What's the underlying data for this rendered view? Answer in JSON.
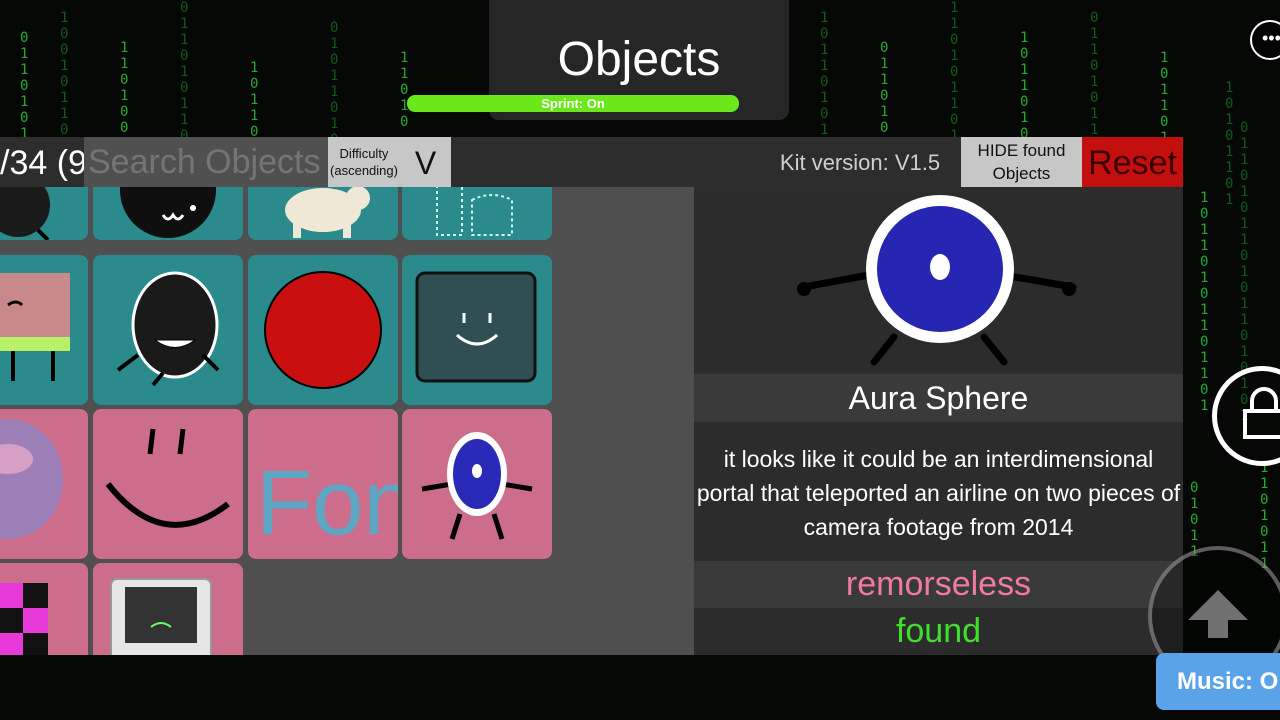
{
  "header": {
    "title": "Objects",
    "sprint_label": "Sprint: On"
  },
  "toolbar": {
    "count_text": "/34 (9",
    "search_placeholder": "Search Objects",
    "sort_label_1": "Difficulty",
    "sort_label_2": "(ascending)",
    "sort_toggle": "V",
    "kit_version": "Kit version: V1.5",
    "hide_found_1": "HIDE found",
    "hide_found_2": "Objects",
    "reset": "Reset"
  },
  "grid": {
    "items": [
      {
        "icon": "dark-ball-character-icon",
        "tile": "teal"
      },
      {
        "icon": "black-ball-face-icon",
        "tile": "teal"
      },
      {
        "icon": "dog-icon",
        "tile": "teal"
      },
      {
        "icon": "dotted-outline-icon",
        "tile": "teal"
      },
      {
        "icon": "sad-box-character-icon",
        "tile": "teal"
      },
      {
        "icon": "black-leaf-character-icon",
        "tile": "teal"
      },
      {
        "icon": "red-ball-icon",
        "tile": "teal"
      },
      {
        "icon": "smiling-square-icon",
        "tile": "teal"
      },
      {
        "icon": "crewmate-icon",
        "tile": "pink"
      },
      {
        "icon": "smiley-face-icon",
        "tile": "pink"
      },
      {
        "icon": "font-text-icon",
        "tile": "pink",
        "text": "Font"
      },
      {
        "icon": "aura-sphere-icon",
        "tile": "pink"
      },
      {
        "icon": "checkered-cube-icon",
        "tile": "pink"
      },
      {
        "icon": "handheld-console-icon",
        "tile": "pink"
      }
    ]
  },
  "detail": {
    "name": "Aura Sphere",
    "description": "it looks like it could be an interdimensional portal that teleported an airline on two pieces of camera footage from 2014",
    "difficulty": "remorseless",
    "status": "found"
  },
  "hud": {
    "music_label": "Music: O"
  },
  "colors": {
    "found": "#3fe02a",
    "difficulty": "#f07aa2",
    "reset": "#c40f0f",
    "sprint": "#6be81a"
  }
}
